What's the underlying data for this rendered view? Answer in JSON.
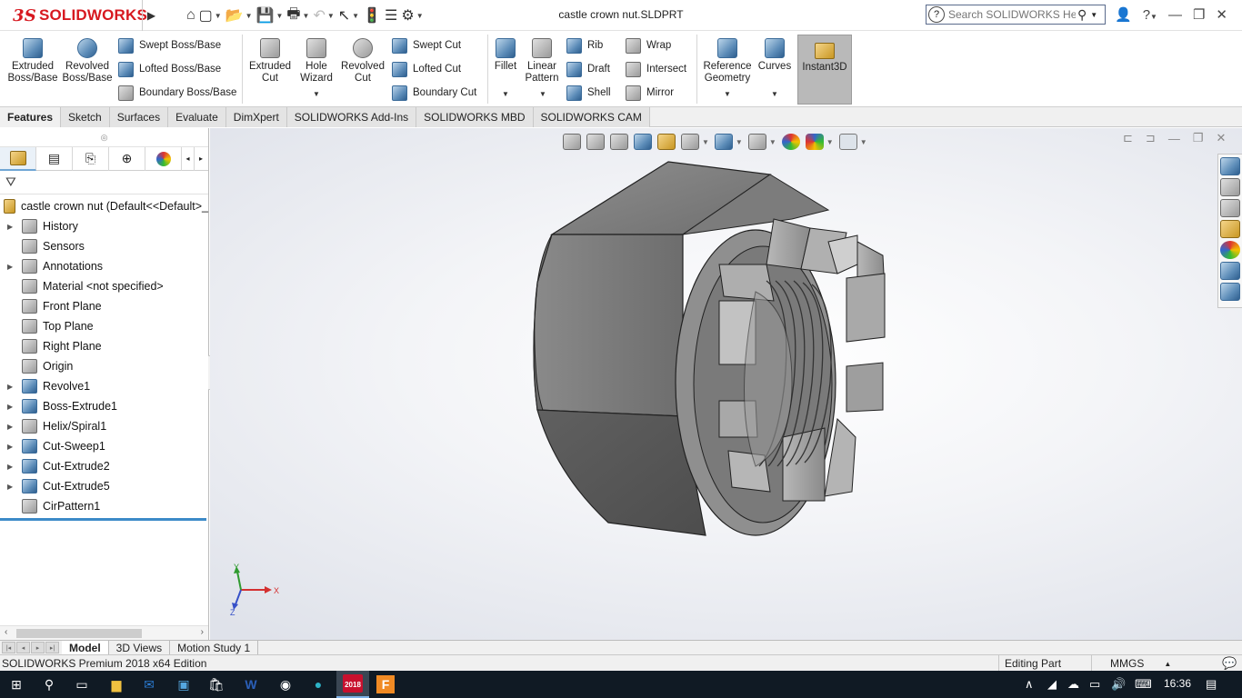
{
  "app": {
    "brand": "SOLIDWORKS",
    "brand_mark": "3S",
    "document_title": "castle crown nut.SLDPRT",
    "help_search_placeholder": "Search SOLIDWORKS Help",
    "help_glyph": "?"
  },
  "quick_access": {
    "icons": [
      "home-icon",
      "new-document-icon",
      "open-folder-icon",
      "save-icon",
      "print-icon",
      "undo-icon",
      "select-arrow-icon",
      "rebuild-icon",
      "file-properties-icon",
      "options-gear-icon"
    ]
  },
  "command_manager": {
    "extruded_boss": "Extruded Boss/Base",
    "revolved_boss": "Revolved Boss/Base",
    "swept_boss": "Swept Boss/Base",
    "lofted_boss": "Lofted Boss/Base",
    "boundary_boss": "Boundary Boss/Base",
    "extruded_cut": "Extruded Cut",
    "hole_wizard": "Hole Wizard",
    "revolved_cut": "Revolved Cut",
    "swept_cut": "Swept Cut",
    "lofted_cut": "Lofted Cut",
    "boundary_cut": "Boundary Cut",
    "fillet": "Fillet",
    "linear_pattern": "Linear Pattern",
    "rib": "Rib",
    "draft": "Draft",
    "shell": "Shell",
    "wrap": "Wrap",
    "intersect": "Intersect",
    "mirror": "Mirror",
    "reference_geometry": "Reference Geometry",
    "curves": "Curves",
    "instant3d": "Instant3D"
  },
  "tabs": [
    "Features",
    "Sketch",
    "Surfaces",
    "Evaluate",
    "DimXpert",
    "SOLIDWORKS Add-Ins",
    "SOLIDWORKS MBD",
    "SOLIDWORKS CAM"
  ],
  "active_tab": "Features",
  "feature_tree": {
    "root": "castle crown nut  (Default<<Default>_",
    "items": [
      {
        "label": "History",
        "expandable": true,
        "icon": "history-folder-icon"
      },
      {
        "label": "Sensors",
        "expandable": false,
        "icon": "sensors-icon"
      },
      {
        "label": "Annotations",
        "expandable": true,
        "icon": "annotations-icon"
      },
      {
        "label": "Material <not specified>",
        "expandable": false,
        "icon": "material-icon"
      },
      {
        "label": "Front Plane",
        "expandable": false,
        "icon": "plane-icon"
      },
      {
        "label": "Top Plane",
        "expandable": false,
        "icon": "plane-icon"
      },
      {
        "label": "Right Plane",
        "expandable": false,
        "icon": "plane-icon"
      },
      {
        "label": "Origin",
        "expandable": false,
        "icon": "origin-icon"
      },
      {
        "label": "Revolve1",
        "expandable": true,
        "icon": "revolve-feature-icon"
      },
      {
        "label": "Boss-Extrude1",
        "expandable": true,
        "icon": "extrude-feature-icon"
      },
      {
        "label": "Helix/Spiral1",
        "expandable": true,
        "icon": "helix-icon"
      },
      {
        "label": "Cut-Sweep1",
        "expandable": true,
        "icon": "cut-sweep-icon"
      },
      {
        "label": "Cut-Extrude2",
        "expandable": true,
        "icon": "cut-extrude-icon"
      },
      {
        "label": "Cut-Extrude5",
        "expandable": true,
        "icon": "cut-extrude-icon"
      },
      {
        "label": "CirPattern1",
        "expandable": false,
        "icon": "circular-pattern-icon"
      }
    ]
  },
  "triad": {
    "x": "X",
    "y": "Y",
    "z": "Z"
  },
  "model_tabs": [
    "Model",
    "3D Views",
    "Motion Study 1"
  ],
  "active_model_tab": "Model",
  "status_bar": {
    "edition": "SOLIDWORKS Premium 2018 x64 Edition",
    "mode": "Editing Part",
    "units": "MMGS"
  },
  "taskbar": {
    "clock": "16:36",
    "solidworks_badge": "2018"
  },
  "colors": {
    "brand_red": "#d71920",
    "nut_face": "#7a7a7a",
    "nut_dark": "#5a5a5a",
    "nut_light": "#a8a8a8",
    "instant3d_active": "#b9b9b9",
    "tree_selection": "#3c8ac8"
  }
}
